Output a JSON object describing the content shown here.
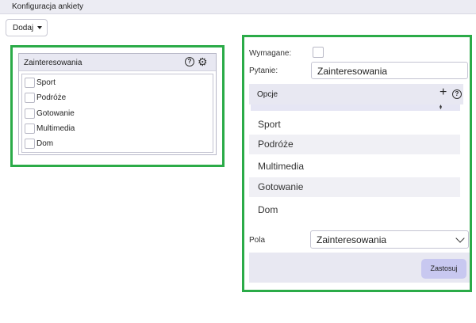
{
  "window": {
    "title": "Konfiguracja ankiety"
  },
  "toolbar": {
    "add_label": "Dodaj"
  },
  "preview": {
    "title": "Zainteresowania",
    "options": [
      "Sport",
      "Podróże",
      "Gotowanie",
      "Multimedia",
      "Dom"
    ],
    "help_icon": "help-icon",
    "settings_icon": "gear-icon"
  },
  "editor": {
    "required_label": "Wymagane:",
    "required_checked": false,
    "question_label": "Pytanie:",
    "question_value": "Zainteresowania",
    "options_header": "Opcje",
    "options": [
      "Sport",
      "Podróże",
      "Multimedia",
      "Gotowanie",
      "Dom"
    ],
    "field_label": "Pola",
    "field_value": "Zainteresowania",
    "apply_label": "Zastosuj"
  },
  "colors": {
    "highlight": "#2bab48",
    "header": "#e8e8f2",
    "apply_button": "#c8c8f0"
  }
}
